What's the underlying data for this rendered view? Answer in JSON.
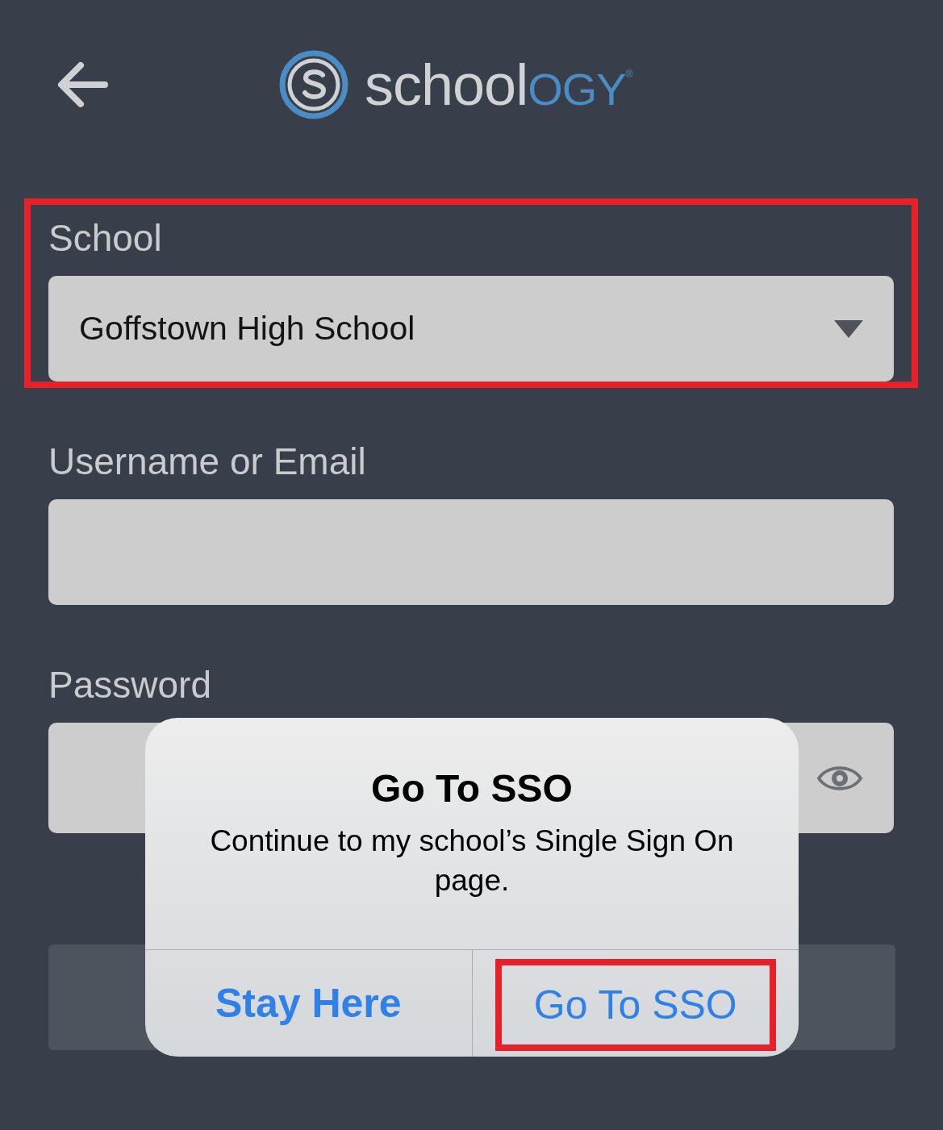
{
  "header": {
    "logo": {
      "part_1": "school",
      "part_2": "OGY",
      "mark": "®"
    }
  },
  "fields": [
    {
      "kind": "select",
      "label": "School",
      "value": "Goffstown High School",
      "highlighted": true
    },
    {
      "kind": "text",
      "label": "Username or Email",
      "highlighted": false
    },
    {
      "kind": "password",
      "label": "Password",
      "highlighted": false
    }
  ],
  "dialog": {
    "title": "Go To SSO",
    "message": "Continue to my school’s Single Sign On page.",
    "buttons": [
      {
        "label": "Stay Here",
        "bold": true,
        "highlighted": false
      },
      {
        "label": "Go To SSO",
        "bold": false,
        "highlighted": true
      }
    ]
  }
}
